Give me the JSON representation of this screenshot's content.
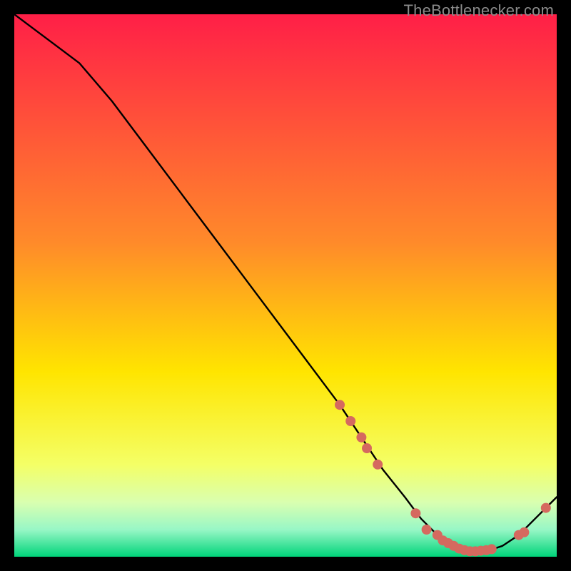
{
  "watermark": "TheBottlenecker.com",
  "colors": {
    "top": "#ff1f47",
    "mid_upper": "#ff8a2a",
    "mid": "#ffe500",
    "mid_low1": "#f4ff66",
    "mid_low2": "#d9ffb0",
    "mid_low3": "#98f7c6",
    "bottom": "#00d47a",
    "curve": "#000000",
    "marker": "#d5695f"
  },
  "chart_data": {
    "type": "line",
    "title": "",
    "xlabel": "",
    "ylabel": "",
    "xlim": [
      0,
      100
    ],
    "ylim": [
      0,
      100
    ],
    "series": [
      {
        "name": "bottleneck-curve",
        "x": [
          0,
          4,
          8,
          12,
          18,
          24,
          30,
          36,
          42,
          48,
          54,
          60,
          64,
          68,
          72,
          75,
          78,
          81,
          84,
          87,
          90,
          93,
          96,
          98,
          100
        ],
        "y": [
          100,
          97,
          94,
          91,
          84,
          76,
          68,
          60,
          52,
          44,
          36,
          28,
          22,
          16,
          11,
          7,
          4,
          2,
          1,
          1,
          2,
          4,
          7,
          9,
          11
        ]
      }
    ],
    "markers": {
      "name": "highlighted-points",
      "x": [
        60,
        62,
        64,
        65,
        67,
        74,
        76,
        78,
        79,
        80,
        81,
        82,
        83,
        84,
        85,
        86,
        87,
        88,
        93,
        94,
        98
      ],
      "y": [
        28,
        25,
        22,
        20,
        17,
        8,
        5,
        4,
        3,
        2.5,
        2,
        1.5,
        1.2,
        1,
        1,
        1.1,
        1.2,
        1.4,
        4,
        4.5,
        9
      ]
    }
  }
}
